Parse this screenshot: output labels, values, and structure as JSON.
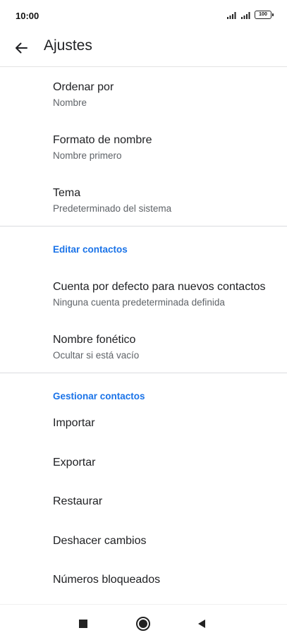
{
  "status_bar": {
    "time": "10:00",
    "battery": "100"
  },
  "app_bar": {
    "title": "Ajustes"
  },
  "display_items": [
    {
      "title": "Ordenar por",
      "summary": "Nombre"
    },
    {
      "title": "Formato de nombre",
      "summary": "Nombre primero"
    },
    {
      "title": "Tema",
      "summary": "Predeterminado del sistema"
    }
  ],
  "edit_section": {
    "header": "Editar contactos",
    "items": [
      {
        "title": "Cuenta por defecto para nuevos contactos",
        "summary": "Ninguna cuenta predeterminada definida"
      },
      {
        "title": "Nombre fonético",
        "summary": "Ocultar si está vacío"
      }
    ]
  },
  "manage_section": {
    "header": "Gestionar contactos",
    "items": [
      {
        "title": "Importar"
      },
      {
        "title": "Exportar"
      },
      {
        "title": "Restaurar"
      },
      {
        "title": "Deshacer cambios"
      },
      {
        "title": "Números bloqueados"
      }
    ]
  },
  "icons": {
    "back": "arrow-back-icon",
    "signal": "signal-icon",
    "battery": "battery-icon",
    "nav_recents": "square-icon",
    "nav_home": "circle-icon",
    "nav_back": "triangle-back-icon"
  },
  "colors": {
    "accent": "#1a73e8",
    "primary_text": "#202124",
    "secondary_text": "#5f6368",
    "divider": "#dadce0"
  }
}
